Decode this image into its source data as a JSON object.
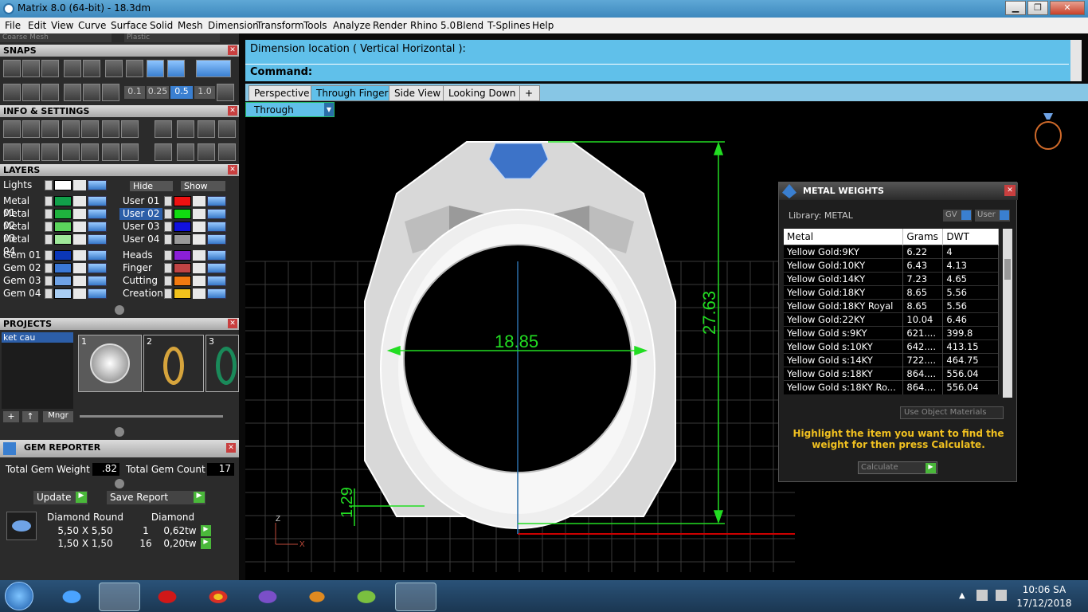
{
  "window": {
    "title": "Matrix 8.0 (64-bit) - 18.3dm",
    "minimize": "▁",
    "maximize": "❐",
    "close": "✕"
  },
  "menu": [
    "File",
    "Edit",
    "View",
    "Curve",
    "Surface",
    "Solid",
    "Mesh",
    "Dimension",
    "Transform",
    "Tools",
    "Analyze",
    "Render",
    "Rhino 5.0",
    "Blend",
    "T-Splines",
    "Help"
  ],
  "top_dropdowns": {
    "left": "Coarse Mesh",
    "right": "Plastic"
  },
  "panels": {
    "snaps": "SNAPS",
    "info": "INFO & SETTINGS",
    "layers": "LAYERS",
    "projects": "PROJECTS",
    "gem_reporter": "GEM REPORTER"
  },
  "snap_values": [
    "0.1",
    "0.25",
    "0.5",
    "1.0"
  ],
  "layers": {
    "lights": "Lights",
    "hide": "Hide",
    "show": "Show",
    "left": [
      {
        "name": "Metal 01",
        "color": "#11a04a"
      },
      {
        "name": "Metal 02",
        "color": "#1fb23e"
      },
      {
        "name": "Metal 03",
        "color": "#5bd45c"
      },
      {
        "name": "Metal 04",
        "color": "#9fe89a"
      },
      {
        "name": "Gem 01",
        "color": "#0b37b8"
      },
      {
        "name": "Gem 02",
        "color": "#3a78d6"
      },
      {
        "name": "Gem 03",
        "color": "#6fa3e6"
      },
      {
        "name": "Gem 04",
        "color": "#a8cdf3"
      }
    ],
    "right": [
      {
        "name": "User 01",
        "color": "#ee1111"
      },
      {
        "name": "User 02",
        "color": "#11dd11",
        "selected": true
      },
      {
        "name": "User 03",
        "color": "#1111dd"
      },
      {
        "name": "User 04",
        "color": "#9a9a9a"
      },
      {
        "name": "Heads",
        "color": "#8a1fd6"
      },
      {
        "name": "Finger",
        "color": "#c04444"
      },
      {
        "name": "Cutting",
        "color": "#f27a10"
      },
      {
        "name": "Creation",
        "color": "#f2c21c"
      }
    ]
  },
  "projects": {
    "item": "ket cau",
    "thumbs": [
      "1",
      "2",
      "3"
    ],
    "mngr": "Mngr"
  },
  "gem_reporter": {
    "total_weight_label": "Total Gem Weight",
    "total_weight": ".82",
    "total_count_label": "Total Gem Count",
    "total_count": "17",
    "update": "Update",
    "save_report": "Save Report",
    "col1": "Diamond Round",
    "col2": "Diamond",
    "rows": [
      {
        "size": "5,50 X 5,50",
        "count": "1",
        "tw": "0,62tw"
      },
      {
        "size": "1,50 X 1,50",
        "count": "16",
        "tw": "0,20tw"
      }
    ]
  },
  "command": {
    "line1": "Dimension location ( Vertical  Horizontal ):",
    "line2": "Command:"
  },
  "tabs": [
    "Perspective",
    "Through Finger",
    "Side View",
    "Looking Down",
    "+"
  ],
  "active_tab": "Through Finger",
  "viewport_label": "Through Finger",
  "dimensions": {
    "width": "18.85",
    "height": "27.63",
    "bottom": "1.29"
  },
  "axis": {
    "z": "Z",
    "x": "X"
  },
  "metal_weights": {
    "title": "METAL WEIGHTS",
    "library": "Library: METAL",
    "gv": "GV",
    "user": "User",
    "headers": [
      "Metal",
      "Grams",
      "DWT"
    ],
    "rows": [
      [
        "Yellow Gold:9KY",
        "6.22",
        "4"
      ],
      [
        "Yellow Gold:10KY",
        "6.43",
        "4.13"
      ],
      [
        "Yellow Gold:14KY",
        "7.23",
        "4.65"
      ],
      [
        "Yellow Gold:18KY",
        "8.65",
        "5.56"
      ],
      [
        "Yellow Gold:18KY Royal",
        "8.65",
        "5.56"
      ],
      [
        "Yellow Gold:22KY",
        "10.04",
        "6.46"
      ],
      [
        "Yellow Gold s:9KY",
        "621....",
        "399.8"
      ],
      [
        "Yellow Gold s:10KY",
        "642....",
        "413.15"
      ],
      [
        "Yellow Gold s:14KY",
        "722....",
        "464.75"
      ],
      [
        "Yellow Gold s:18KY",
        "864....",
        "556.04"
      ],
      [
        "Yellow Gold s:18KY Ro...",
        "864....",
        "556.04"
      ]
    ],
    "use_object": "Use Object Materials",
    "hint": "Highlight the item you want to find the weight for then press Calculate.",
    "calculate": "Calculate"
  },
  "taskbar": {
    "time": "10:06 SA",
    "date": "17/12/2018"
  }
}
